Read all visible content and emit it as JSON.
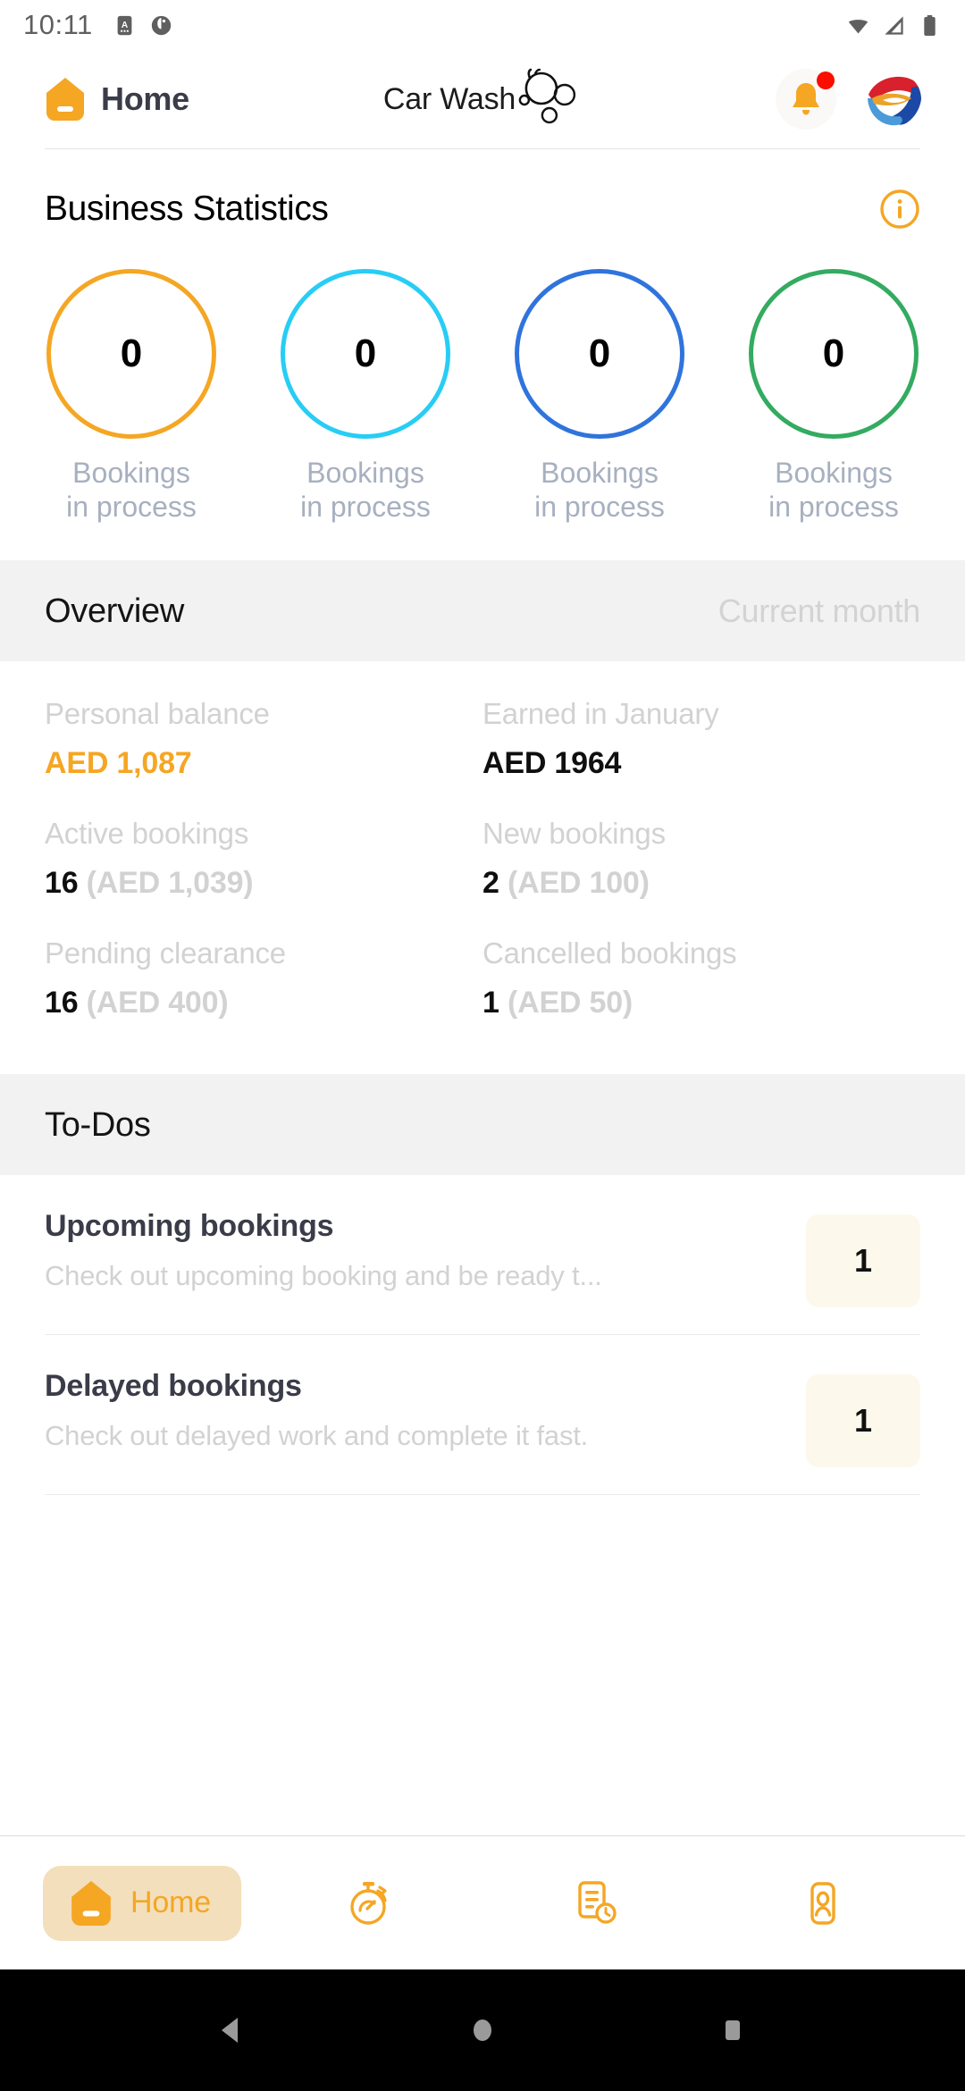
{
  "status_bar": {
    "time": "10:11",
    "left_icons": [
      "screenshot-icon",
      "vpn-icon"
    ],
    "right_icons": [
      "wifi-icon",
      "cellular-signal-icon",
      "battery-icon"
    ]
  },
  "header": {
    "home_icon": "home-icon",
    "brand_label": "Home",
    "center_logo_text": "Car Wash",
    "center_logo_mark": "bubbles-icon",
    "bell_icon": "bell-icon",
    "has_notification": true,
    "avatar_icon": "profile-avatar"
  },
  "business_statistics": {
    "title": "Business Statistics",
    "info_icon": "info-icon",
    "stats": [
      {
        "value": "0",
        "label": "Bookings\nin process",
        "color": "#f5a623"
      },
      {
        "value": "0",
        "label": "Bookings\nin process",
        "color": "#27cdf5"
      },
      {
        "value": "0",
        "label": "Bookings\nin process",
        "color": "#2f74dd"
      },
      {
        "value": "0",
        "label": "Bookings\nin process",
        "color": "#33ab60"
      }
    ]
  },
  "overview": {
    "title": "Overview",
    "period": "Current month",
    "rows": [
      [
        {
          "label": "Personal balance",
          "value": "AED 1,087",
          "sub": "",
          "accent": true
        },
        {
          "label": "Earned in January",
          "value": "AED 1964",
          "sub": "",
          "accent": false
        }
      ],
      [
        {
          "label": "Active bookings",
          "value": "16",
          "sub": " (AED 1,039)",
          "accent": false
        },
        {
          "label": "New bookings",
          "value": "2",
          "sub": " (AED 100)",
          "accent": false
        }
      ],
      [
        {
          "label": "Pending clearance",
          "value": "16",
          "sub": " (AED 400)",
          "accent": false
        },
        {
          "label": "Cancelled bookings",
          "value": "1",
          "sub": " (AED 50)",
          "accent": false
        }
      ]
    ]
  },
  "todos": {
    "title": "To-Dos",
    "items": [
      {
        "title": "Upcoming bookings",
        "description": "Check out upcoming booking and be ready t...",
        "count": "1"
      },
      {
        "title": "Delayed bookings",
        "description": "Check out delayed work and complete it fast.",
        "count": "1"
      }
    ]
  },
  "tabbar": {
    "items": [
      {
        "icon": "home-icon",
        "label": "Home",
        "active": true
      },
      {
        "icon": "stopwatch-icon",
        "label": "",
        "active": false
      },
      {
        "icon": "document-clock-icon",
        "label": "",
        "active": false
      },
      {
        "icon": "user-card-icon",
        "label": "",
        "active": false
      }
    ]
  },
  "android_nav": {
    "back": "back-triangle-icon",
    "home": "home-circle-icon",
    "recents": "recents-square-icon"
  },
  "colors": {
    "accent": "#f5a623",
    "dark_text": "#3b3c49",
    "muted_text": "#d2d2d2",
    "label_blue_grey": "#a7b0c0",
    "section_bg": "#f2f2f2",
    "badge_bg": "#fdf8ec",
    "notification_dot": "#fb0d00"
  }
}
